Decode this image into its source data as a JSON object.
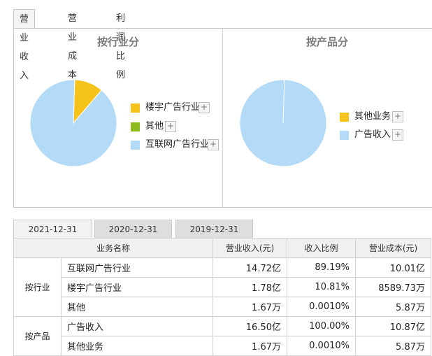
{
  "top_tabs": [
    {
      "label": "营业收入",
      "active": true
    },
    {
      "label": "营业成本",
      "active": false
    },
    {
      "label": "利润比例",
      "active": false
    }
  ],
  "chart_data": [
    {
      "type": "pie",
      "title": "按行业分",
      "categories": [
        "互联网广告行业",
        "楼宇广告行业",
        "其他"
      ],
      "values": [
        89.19,
        10.81,
        0.001
      ],
      "colors": [
        "#b3daf7",
        "#f6c31c",
        "#8dbc1f"
      ],
      "legend": [
        "楼宇广告行业",
        "其他",
        "互联网广告行业"
      ],
      "legend_colors": [
        "#f6c31c",
        "#8dbc1f",
        "#b3daf7"
      ],
      "legend_placement": "right"
    },
    {
      "type": "pie",
      "title": "按产品分",
      "categories": [
        "广告收入",
        "其他业务"
      ],
      "values": [
        100.0,
        0.001
      ],
      "colors": [
        "#b3daf7",
        "#f6c31c"
      ],
      "legend": [
        "其他业务",
        "广告收入"
      ],
      "legend_colors": [
        "#f6c31c",
        "#b3daf7"
      ],
      "legend_placement": "right"
    }
  ],
  "legend_plus": "+",
  "year_tabs": [
    {
      "label": "2021-12-31",
      "active": true
    },
    {
      "label": "2020-12-31",
      "active": false
    },
    {
      "label": "2019-12-31",
      "active": false
    }
  ],
  "table": {
    "headers": [
      "业务名称",
      "营业收入(元)",
      "收入比例",
      "营业成本(元)"
    ],
    "groups": [
      {
        "label": "按行业",
        "rows": [
          {
            "name": "互联网广告行业",
            "revenue": "14.72亿",
            "ratio": "89.19%",
            "cost": "10.01亿"
          },
          {
            "name": "楼宇广告行业",
            "revenue": "1.78亿",
            "ratio": "10.81%",
            "cost": "8589.73万"
          },
          {
            "name": "其他",
            "revenue": "1.67万",
            "ratio": "0.0010%",
            "cost": "5.87万"
          }
        ]
      },
      {
        "label": "按产品",
        "rows": [
          {
            "name": "广告收入",
            "revenue": "16.50亿",
            "ratio": "100.00%",
            "cost": "10.87亿"
          },
          {
            "name": "其他业务",
            "revenue": "1.67万",
            "ratio": "0.0010%",
            "cost": "5.87万"
          }
        ]
      }
    ]
  }
}
